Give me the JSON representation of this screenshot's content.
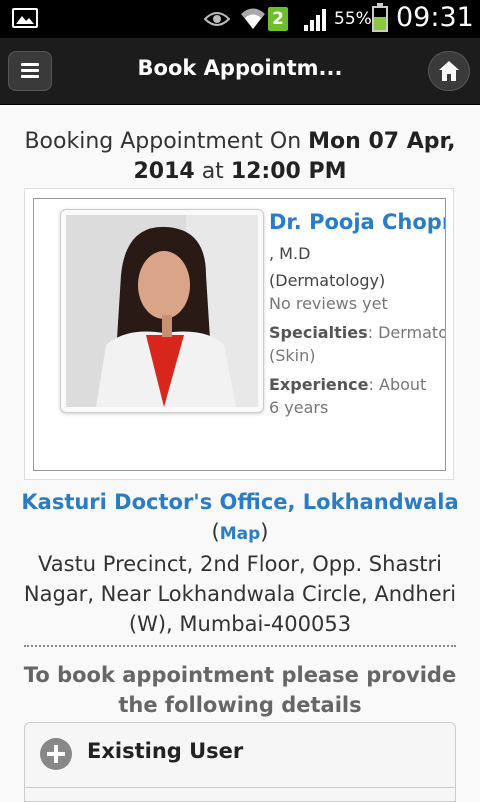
{
  "status_bar": {
    "badge": "2",
    "battery_pct": "55%",
    "battery_level": 0.55,
    "time": "09:31",
    "icons": [
      "image-icon",
      "eye-icon",
      "wifi-icon",
      "signal-icon",
      "battery-icon"
    ]
  },
  "app_bar": {
    "title": "Book Appointm...",
    "menu_icon": "menu-icon",
    "home_icon": "home-icon"
  },
  "booking": {
    "prefix": "Booking Appointment On",
    "date": "Mon 07 Apr, 2014",
    "at": "at",
    "time": "12:00 PM"
  },
  "doctor": {
    "name": "Dr. Pooja Chopra",
    "degree": "M.D",
    "department": "(Dermatology)",
    "reviews": "No reviews yet",
    "specialties_label": "Specialties",
    "specialties_value": "Dermatology",
    "specialties_value2": "(Skin)",
    "experience_label": "Experience",
    "experience_value": "About",
    "experience_value2": "6 years"
  },
  "office": {
    "name": "Kasturi Doctor's Office, Lokhandwala",
    "map_label": "Map",
    "address": "Vastu Precinct, 2nd Floor, Opp. Shastri Nagar, Near Lokhandwala Circle, Andheri (W), Mumbai-400053"
  },
  "form": {
    "instructions": "To book appointment please provide the following details",
    "existing_user_label": "Existing User"
  },
  "colors": {
    "accent": "#2b7cc6",
    "appbar": "#1c1c1c",
    "background": "#f9f9f9"
  }
}
